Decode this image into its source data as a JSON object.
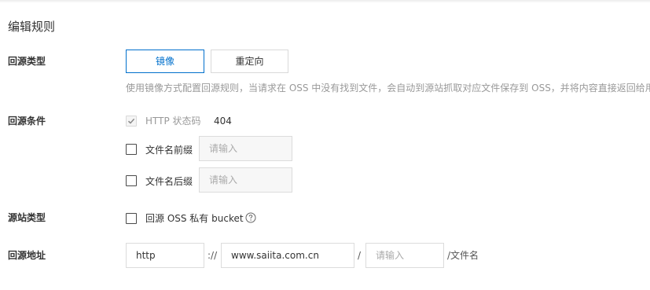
{
  "page": {
    "title": "编辑规则"
  },
  "rows": {
    "origin_type": {
      "label": "回源类型",
      "options": [
        {
          "label": "镜像",
          "selected": true
        },
        {
          "label": "重定向",
          "selected": false
        }
      ],
      "hint": "使用镜像方式配置回源规则，当请求在 OSS 中没有找到文件，会自动到源站抓取对应文件保存到 OSS，并将内容直接返回给用户。"
    },
    "origin_condition": {
      "label": "回源条件",
      "http_status": {
        "label": "HTTP 状态码",
        "value": "404",
        "checked": true,
        "disabled": true
      },
      "prefix": {
        "label": "文件名前缀",
        "checked": false,
        "placeholder": "请输入"
      },
      "suffix": {
        "label": "文件名后缀",
        "checked": false,
        "placeholder": "请输入"
      }
    },
    "source_type": {
      "label": "源站类型",
      "private_bucket": {
        "label": "回源 OSS 私有 bucket",
        "checked": false
      },
      "help_icon": "question-circle-icon"
    },
    "origin_address": {
      "label": "回源地址",
      "protocol": "http",
      "protocol_sep": "://",
      "domain": "www.saiita.com.cn",
      "path_sep": "/",
      "path_placeholder": "请输入",
      "suffix_label": "/文件名"
    }
  },
  "colors": {
    "accent": "#0070cc",
    "text": "#333333",
    "muted": "#999999",
    "border": "#d9d9d9"
  }
}
